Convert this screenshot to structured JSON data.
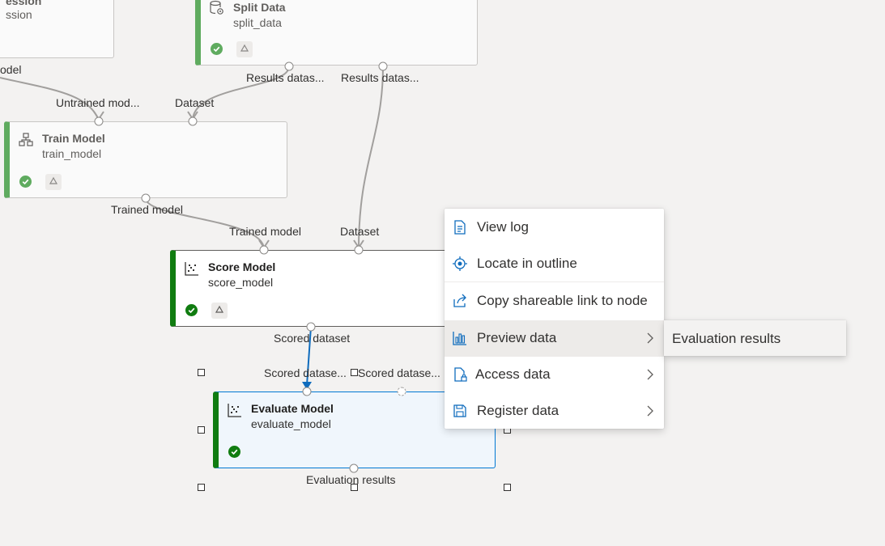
{
  "nodes": {
    "regression": {
      "title": "ession",
      "subtitle": "ssion"
    },
    "split_data": {
      "title": "Split Data",
      "subtitle": "split_data"
    },
    "train_model": {
      "title": "Train Model",
      "subtitle": "train_model"
    },
    "score_model": {
      "title": "Score Model",
      "subtitle": "score_model"
    },
    "evaluate_model": {
      "title": "Evaluate Model",
      "subtitle": "evaluate_model"
    }
  },
  "ports": {
    "regression_out": "odel",
    "split_results_1": "Results datas...",
    "split_results_2": "Results datas...",
    "train_untrained": "Untrained mod...",
    "train_dataset": "Dataset",
    "train_out": "Trained model",
    "score_trained": "Trained model",
    "score_dataset": "Dataset",
    "score_out": "Scored dataset",
    "eval_in_1": "Scored datase...",
    "eval_in_2": "Scored datase...",
    "eval_out": "Evaluation results"
  },
  "context_menu": {
    "items": [
      {
        "label": "View log",
        "icon": "document-icon"
      },
      {
        "label": "Locate in outline",
        "icon": "locate-icon"
      },
      {
        "label": "Copy shareable link to node",
        "icon": "share-icon"
      },
      {
        "label": "Preview data",
        "icon": "bar-chart-icon",
        "submenu": true
      },
      {
        "label": "Access data",
        "icon": "document-lock-icon",
        "submenu": true
      },
      {
        "label": "Register data",
        "icon": "save-icon",
        "submenu": true
      }
    ],
    "submenu_items": [
      "Evaluation results"
    ]
  },
  "colors": {
    "canvas": "#f3f2f1",
    "success": "#107c10",
    "success_faded": "#5fab5f",
    "selection": "#0078d4"
  }
}
